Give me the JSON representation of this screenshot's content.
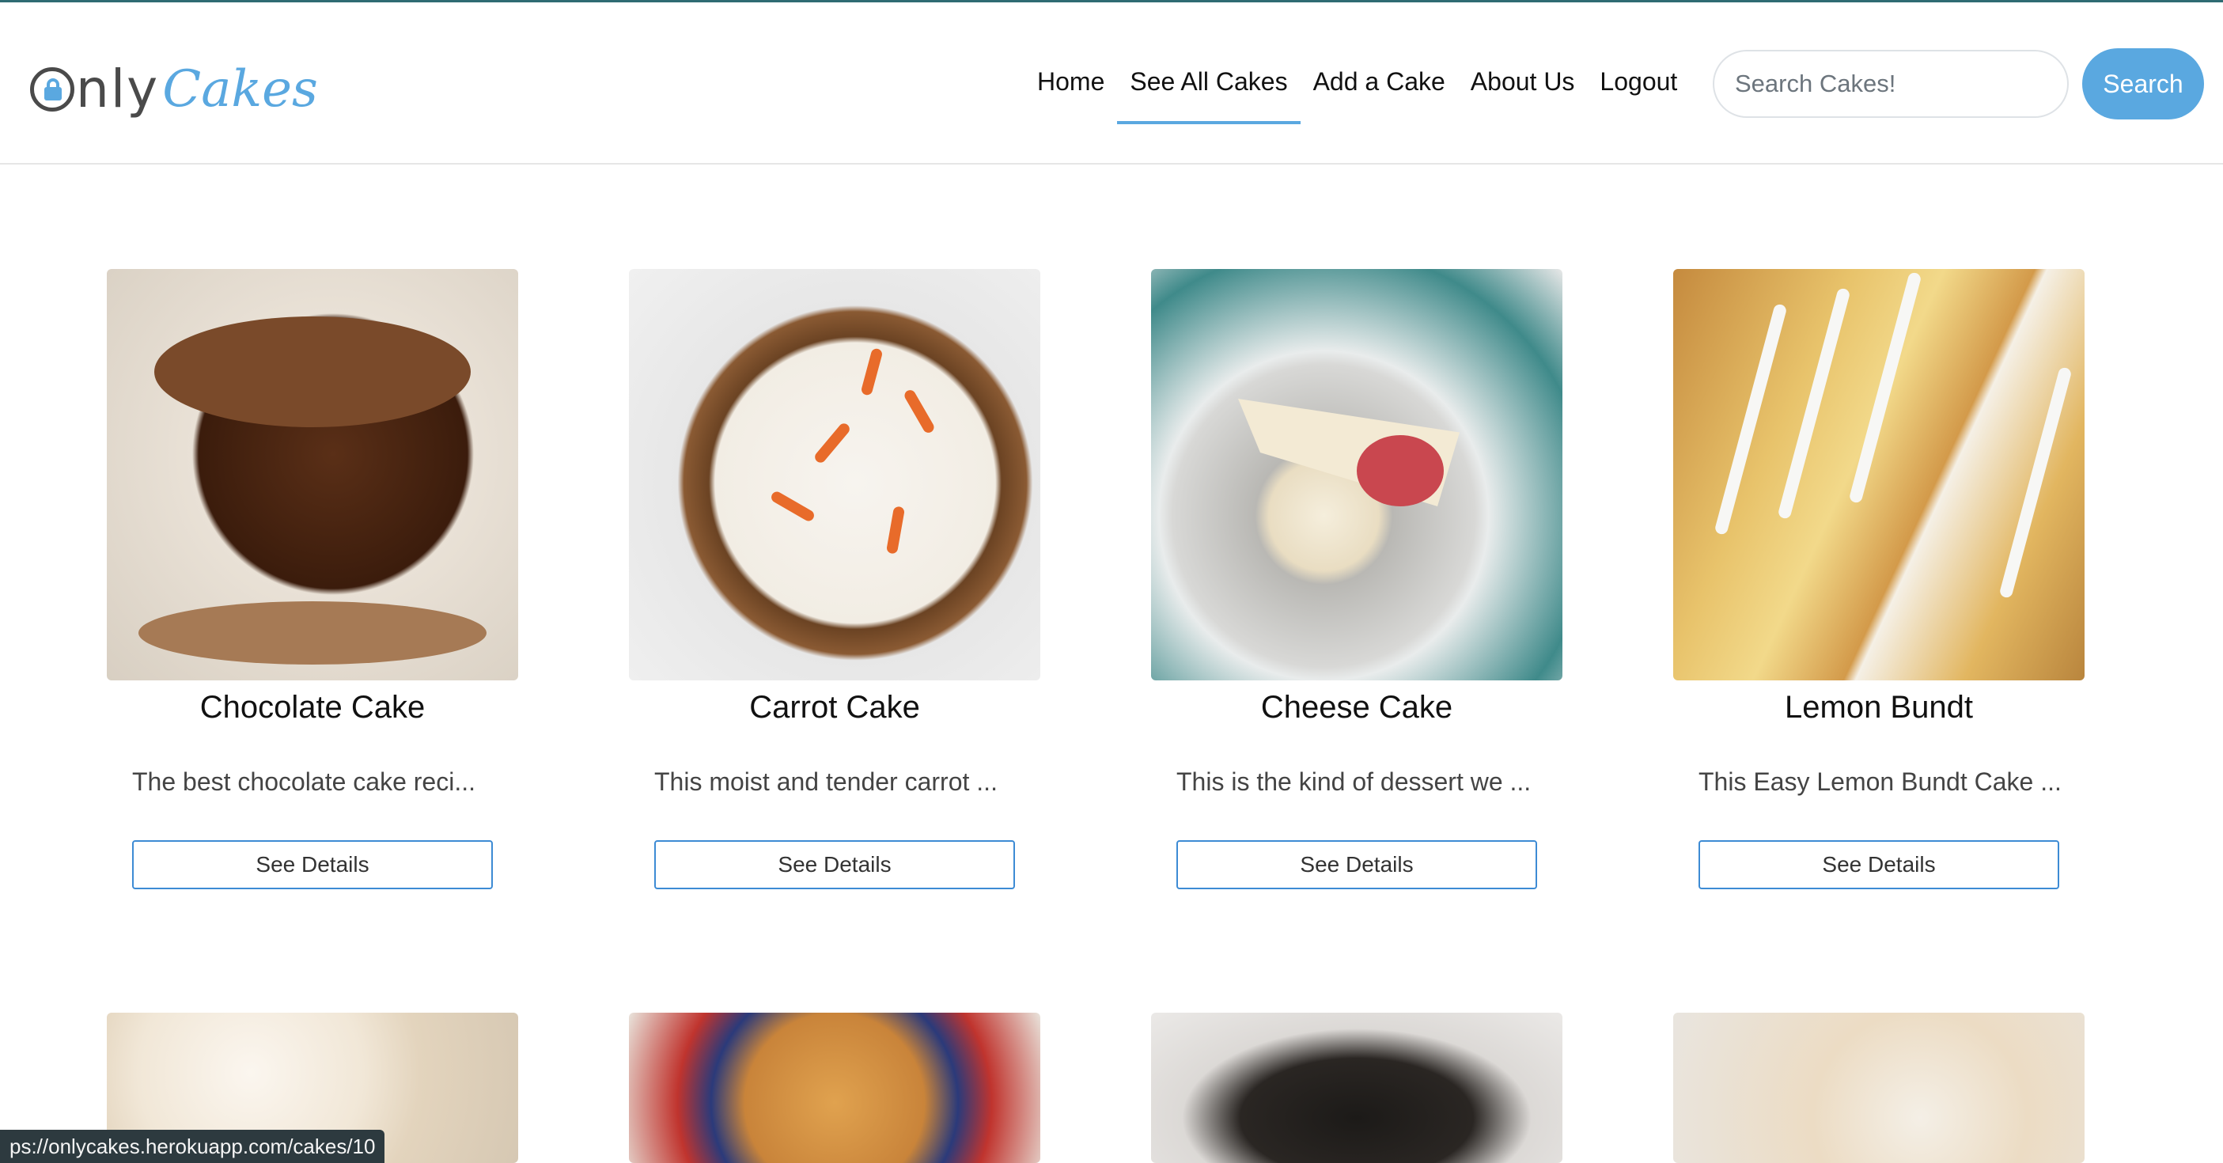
{
  "brand": {
    "name_part1": "nly",
    "name_part2": "Cakes",
    "logo_icon": "lock-icon",
    "accent": "#5aa8e0"
  },
  "nav": {
    "items": [
      {
        "label": "Home",
        "active": false
      },
      {
        "label": "See All Cakes",
        "active": true
      },
      {
        "label": "Add a Cake",
        "active": false
      },
      {
        "label": "About Us",
        "active": false
      },
      {
        "label": "Logout",
        "active": false
      }
    ]
  },
  "search": {
    "placeholder": "Search Cakes!",
    "value": "",
    "button_label": "Search"
  },
  "cakes": [
    {
      "title": "Chocolate Cake",
      "description": "The best chocolate cake reci...",
      "button_label": "See Details"
    },
    {
      "title": "Carrot Cake",
      "description": "This moist and tender carrot ...",
      "button_label": "See Details"
    },
    {
      "title": "Cheese Cake",
      "description": "This is the kind of dessert we ...",
      "button_label": "See Details"
    },
    {
      "title": "Lemon Bundt",
      "description": "This Easy Lemon Bundt Cake ...",
      "button_label": "See Details"
    }
  ],
  "statusbar": {
    "url": "ps://onlycakes.herokuapp.com/cakes/10"
  }
}
